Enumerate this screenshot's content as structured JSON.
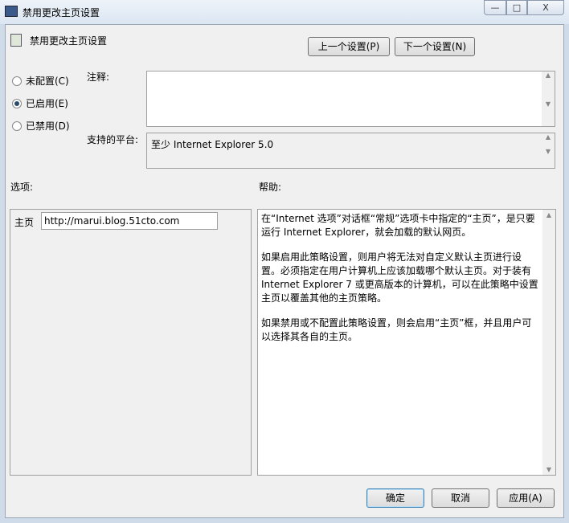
{
  "window": {
    "title": "禁用更改主页设置",
    "minimize": "—",
    "maximize": "□",
    "close": "X"
  },
  "header": {
    "setting_name": "禁用更改主页设置",
    "prev_button": "上一个设置(P)",
    "next_button": "下一个设置(N)"
  },
  "state": {
    "options": [
      {
        "label": "未配置(C)",
        "selected": false
      },
      {
        "label": "已启用(E)",
        "selected": true
      },
      {
        "label": "已禁用(D)",
        "selected": false
      }
    ]
  },
  "comment": {
    "label": "注释:",
    "value": ""
  },
  "platform": {
    "label": "支持的平台:",
    "value": "至少 Internet Explorer 5.0"
  },
  "options_panel": {
    "label": "选项:",
    "homepage_label": "主页",
    "homepage_value": "http://marui.blog.51cto.com"
  },
  "help_panel": {
    "label": "帮助:",
    "paragraphs": [
      "在“Internet 选项”对话框“常规”选项卡中指定的“主页”，是只要运行 Internet Explorer，就会加载的默认网页。",
      "如果启用此策略设置，则用户将无法对自定义默认主页进行设置。必须指定在用户计算机上应该加载哪个默认主页。对于装有 Internet Explorer 7 或更高版本的计算机，可以在此策略中设置主页以覆盖其他的主页策略。",
      "如果禁用或不配置此策略设置，则会启用“主页”框，并且用户可以选择其各自的主页。"
    ]
  },
  "footer": {
    "ok": "确定",
    "cancel": "取消",
    "apply": "应用(A)"
  }
}
